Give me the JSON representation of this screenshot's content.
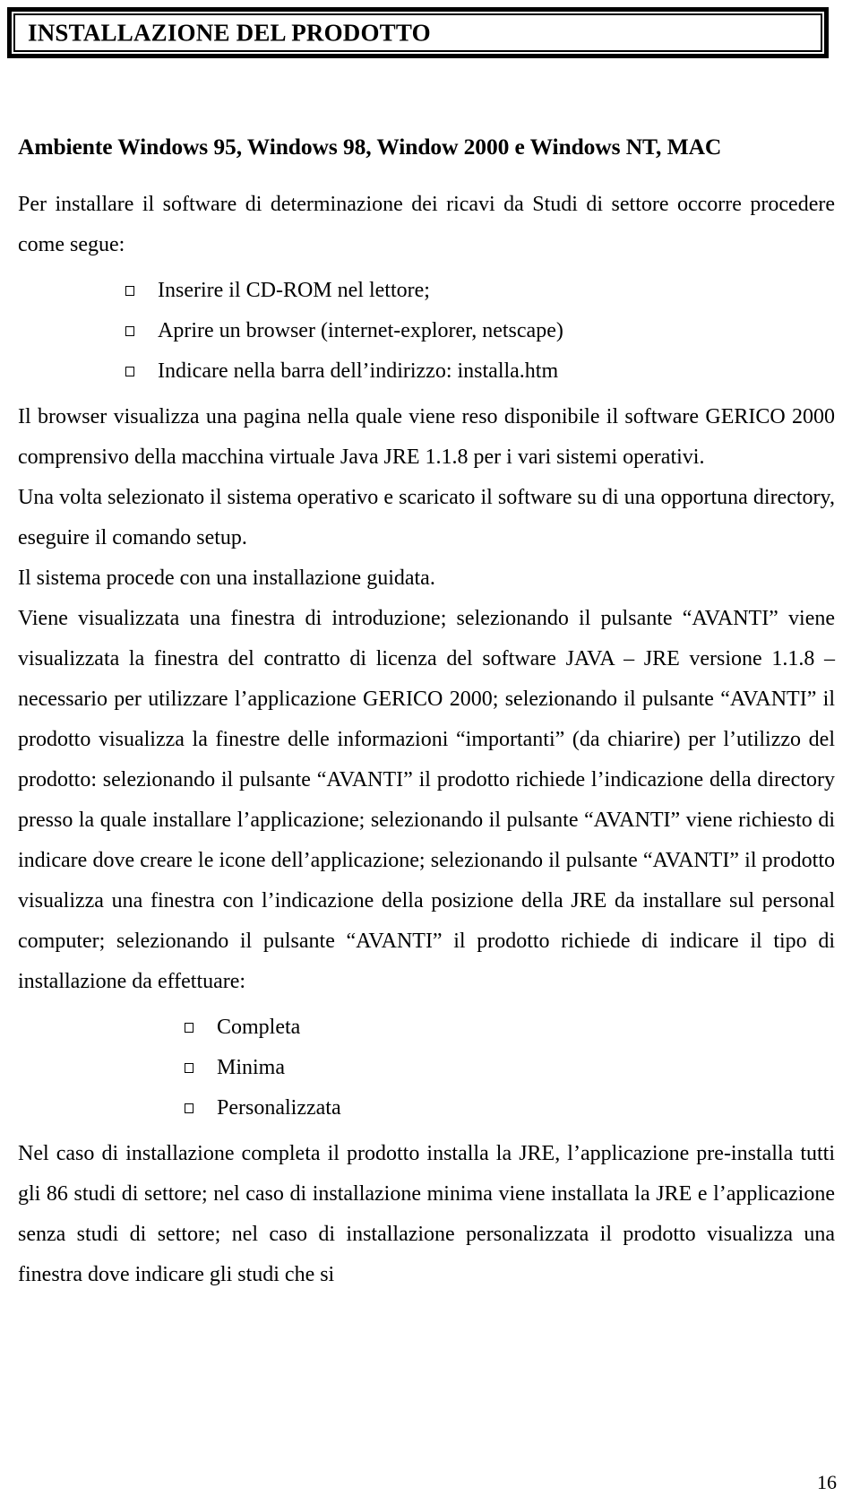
{
  "document": {
    "header_title": "INSTALLAZIONE DEL PRODOTTO",
    "page_number": "16",
    "section_heading": "Ambiente Windows  95, Windows 98, Window 2000 e Windows NT, MAC",
    "paragraphs": {
      "intro": "Per installare il software di determinazione dei ricavi da Studi di settore  occorre procedere come segue:",
      "browser_page": "Il browser visualizza una pagina nella quale viene reso disponibile il software GERICO 2000 comprensivo della macchina virtuale Java JRE 1.1.8 per i vari sistemi operativi.",
      "setup": "Una volta selezionato il sistema operativo e scaricato il software su di una opportuna directory, eseguire il comando setup.",
      "guided": "Il sistema procede con una installazione guidata.",
      "wizard": "Viene visualizzata una finestra di introduzione; selezionando il pulsante “AVANTI” viene visualizzata la finestra del contratto di licenza del software JAVA – JRE versione 1.1.8 – necessario per utilizzare l’applicazione GERICO 2000; selezionando il pulsante “AVANTI”  il prodotto visualizza la finestre delle informazioni “importanti” (da chiarire) per l’utilizzo del prodotto: selezionando il pulsante “AVANTI” il prodotto richiede l’indicazione della directory presso la quale installare l’applicazione; selezionando il pulsante “AVANTI”   viene richiesto di indicare dove creare le icone dell’applicazione; selezionando il pulsante “AVANTI”  il prodotto visualizza una finestra con l’indicazione della posizione della JRE da installare sul personal computer; selezionando il pulsante “AVANTI”  il prodotto richiede di indicare il tipo di installazione da effettuare:",
      "closing": "Nel caso di installazione completa il prodotto installa la JRE, l’applicazione pre-installa tutti gli 86 studi di settore; nel caso di installazione minima viene installata la JRE e l’applicazione senza studi di settore; nel caso di installazione personalizzata il prodotto visualizza una finestra dove indicare gli studi che si"
    },
    "steps": [
      {
        "label": "Inserire il CD-ROM nel lettore;"
      },
      {
        "label": "Aprire un browser (internet-explorer, netscape)"
      },
      {
        "label": "Indicare nella barra dell’indirizzo: installa.htm"
      }
    ],
    "install_types": [
      {
        "label": "Completa"
      },
      {
        "label": "Minima"
      },
      {
        "label": "Personalizzata"
      }
    ],
    "colors": {
      "text": "#000000",
      "background": "#ffffff",
      "border": "#000000"
    }
  }
}
